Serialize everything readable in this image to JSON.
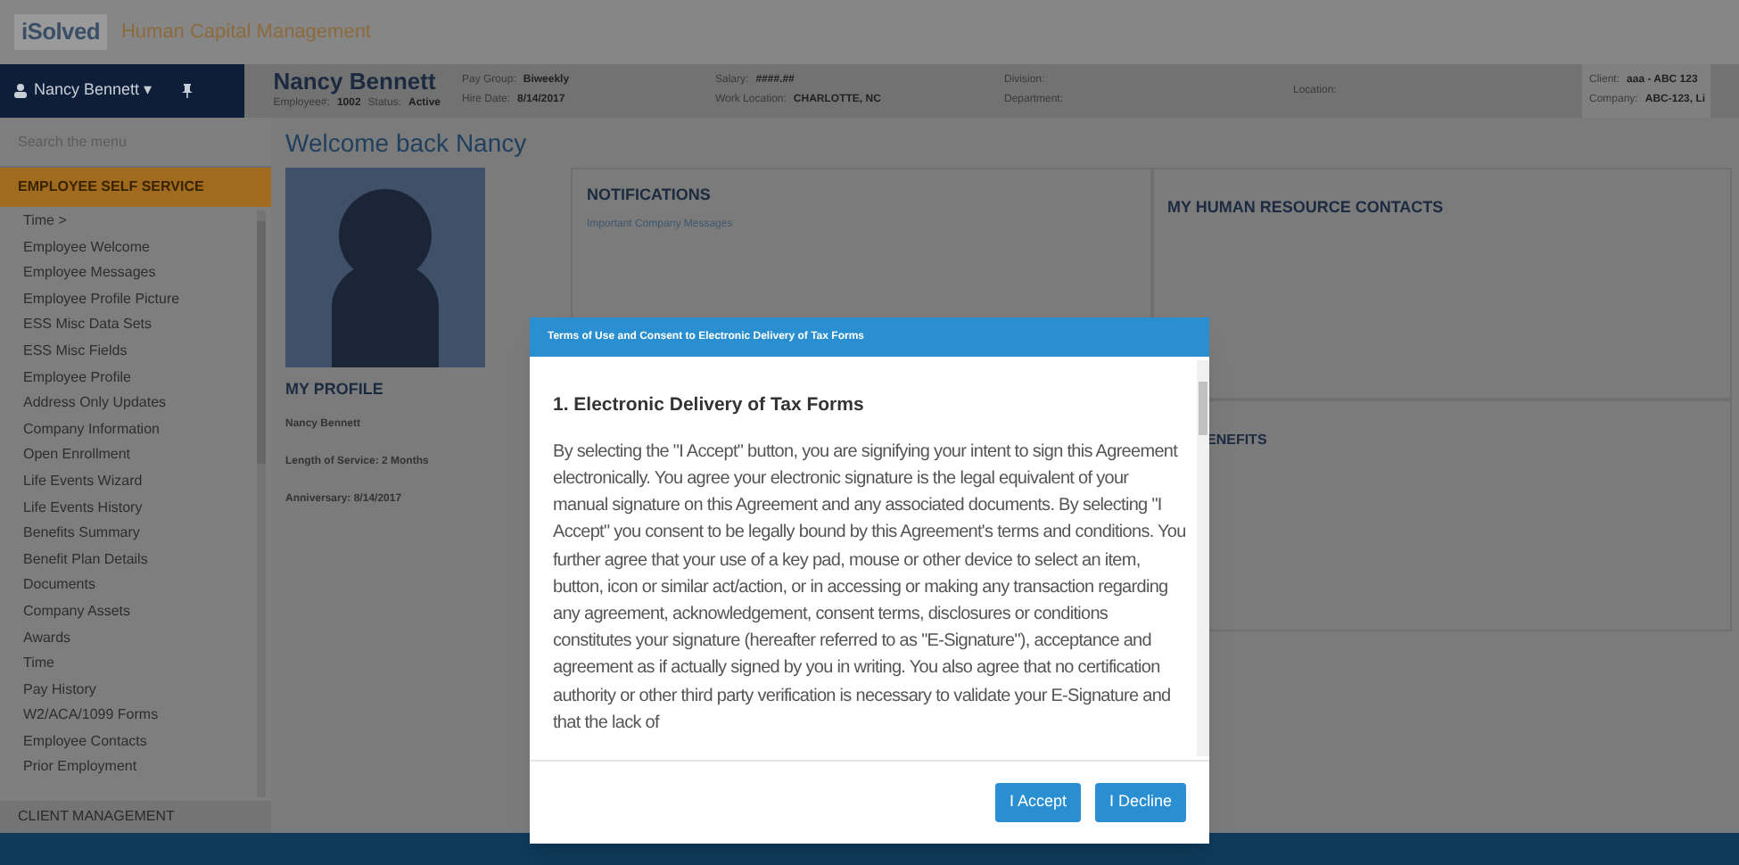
{
  "app": {
    "logo": "iSolved",
    "title": "Human Capital Management"
  },
  "user_menu": {
    "name": "Nancy Bennett",
    "caret": "▾"
  },
  "employee": {
    "name": "Nancy Bennett",
    "sub": [
      {
        "label": "Employee#:",
        "value": "1002"
      },
      {
        "label": "Status:",
        "value": "Active"
      }
    ],
    "fields": [
      [
        {
          "label": "Pay Group:",
          "value": "Biweekly"
        },
        {
          "label": "Hire Date:",
          "value": "8/14/2017"
        }
      ],
      [
        {
          "label": "Salary:",
          "value": "####.##"
        },
        {
          "label": "Work Location:",
          "value": "CHARLOTTE, NC"
        }
      ],
      [
        {
          "label": "Division:"
        },
        {
          "label": "Department:"
        }
      ],
      [
        {
          "label": "Location:"
        }
      ]
    ],
    "client": [
      {
        "label": "Client:",
        "value": "aaa - ABC 123"
      },
      {
        "label": "Company:",
        "value": "ABC-123, Li"
      }
    ]
  },
  "sidebar": {
    "search_placeholder": "Search the menu",
    "section": "EMPLOYEE SELF SERVICE",
    "items": [
      "Time >",
      "Employee Welcome",
      "Employee Messages",
      "Employee Profile Picture",
      "ESS Misc Data Sets",
      "ESS Misc Fields",
      "Employee Profile",
      "Address Only Updates",
      "Company Information",
      "Open Enrollment",
      "Life Events Wizard",
      "Life Events History",
      "Benefits Summary",
      "Benefit Plan Details",
      "Documents",
      "Company Assets",
      "Awards",
      "Time",
      "Pay History",
      "W2/ACA/1099 Forms",
      "Employee Contacts",
      "Prior Employment"
    ],
    "footer_section": "CLIENT MANAGEMENT"
  },
  "welcome": "Welcome back Nancy",
  "profile": {
    "heading": "MY PROFILE",
    "name": "Nancy Bennett",
    "lines": [
      "Length of Service: 2 Months",
      "Anniversary: 8/14/2017"
    ]
  },
  "panels": [
    {
      "heading": "NOTIFICATIONS",
      "text": "Important Company Messages"
    },
    {
      "heading": "MY HUMAN RESOURCE CONTACTS"
    },
    {
      "heading": "ENEFITS"
    }
  ],
  "dialog": {
    "title": "Terms of Use and Consent to Electronic Delivery of Tax Forms",
    "heading": "1. Electronic Delivery of Tax Forms",
    "body": "By selecting the \"I Accept\" button, you are signifying your intent to sign this Agreement electronically. You agree your electronic signature is the legal equivalent of your manual signature on this Agreement and any associated documents. By selecting \"I Accept\" you consent to be legally bound by this Agreement's terms and conditions. You further agree that your use of a key pad, mouse or other device to select an item, button, icon or similar act/action, or in accessing or making any transaction regarding any agreement, acknowledgement, consent terms, disclosures or conditions constitutes your signature (hereafter referred to as \"E-Signature\"), acceptance and agreement as if actually signed by you in writing. You also agree that no certification authority or other third party verification is necessary to validate your E-Signature and that the lack of",
    "buttons": [
      "I Accept",
      "I Decline"
    ]
  }
}
